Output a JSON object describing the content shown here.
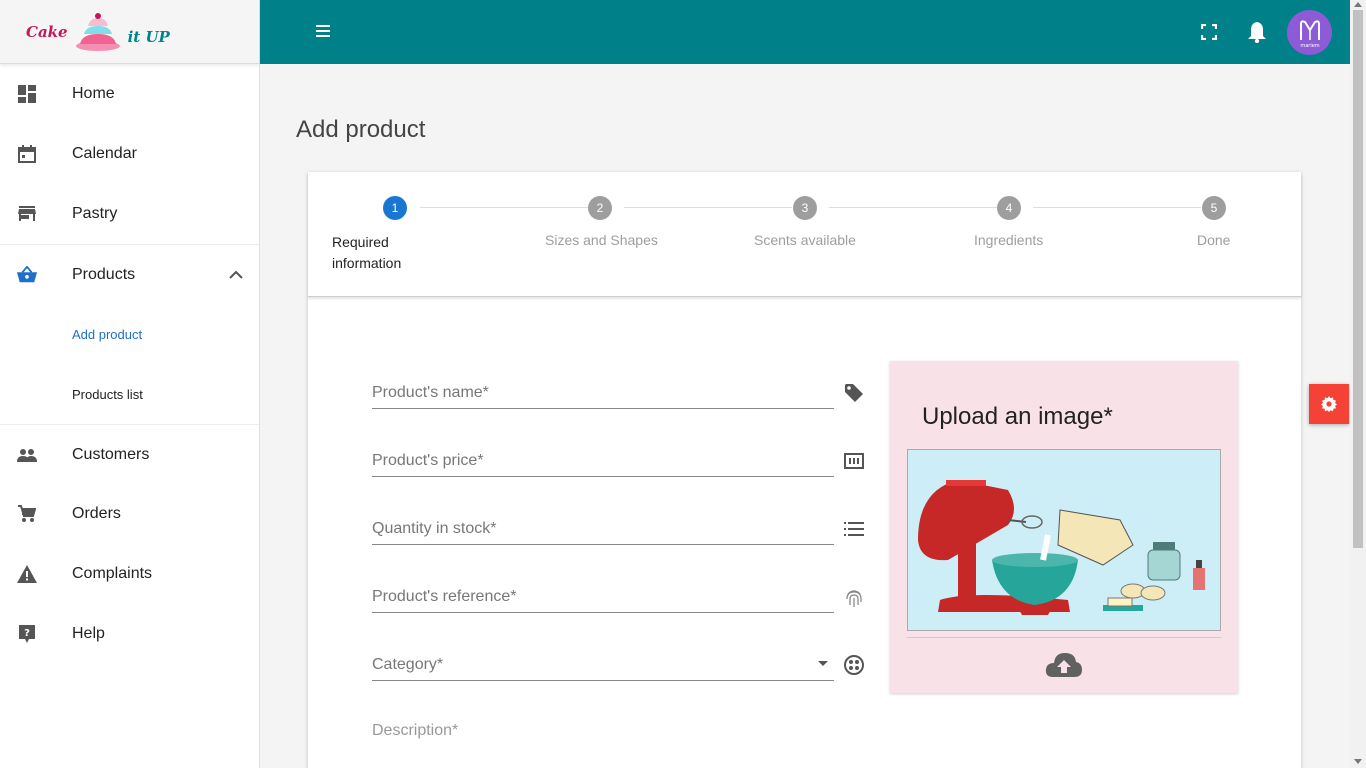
{
  "logo": {
    "text_left": "Cake",
    "text_right": "it UP"
  },
  "sidebar": {
    "items": [
      {
        "label": "Home",
        "icon": "dashboard-icon"
      },
      {
        "label": "Calendar",
        "icon": "calendar-icon"
      },
      {
        "label": "Pastry",
        "icon": "store-icon"
      },
      {
        "label": "Products",
        "icon": "basket-icon"
      },
      {
        "label": "Customers",
        "icon": "people-icon"
      },
      {
        "label": "Orders",
        "icon": "cart-icon"
      },
      {
        "label": "Complaints",
        "icon": "warning-icon"
      },
      {
        "label": "Help",
        "icon": "help-icon"
      }
    ],
    "products_sub": [
      {
        "label": "Add product"
      },
      {
        "label": "Products list"
      }
    ]
  },
  "topbar": {
    "bg_color": "#00818a",
    "avatar_letter": "M",
    "avatar_sub": "mariem"
  },
  "page": {
    "title": "Add product"
  },
  "stepper": {
    "steps": [
      {
        "num": "1",
        "label": "Required information"
      },
      {
        "num": "2",
        "label": "Sizes and Shapes"
      },
      {
        "num": "3",
        "label": "Scents available"
      },
      {
        "num": "4",
        "label": "Ingredients"
      },
      {
        "num": "5",
        "label": "Done"
      }
    ]
  },
  "form": {
    "name_placeholder": "Product's name*",
    "price_placeholder": "Product's price*",
    "qty_placeholder": "Quantity in stock*",
    "ref_placeholder": "Product's reference*",
    "category_placeholder": "Category*",
    "description_label": "Description*"
  },
  "upload": {
    "title": "Upload an image*"
  },
  "colors": {
    "accent": "#1976d2",
    "fab": "#f44336",
    "upload_bg": "#f9e1e8"
  }
}
